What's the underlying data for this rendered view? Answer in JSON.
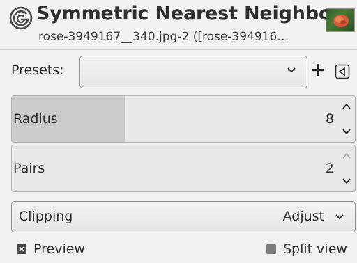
{
  "header": {
    "title": "Symmetric Nearest Neighbor",
    "subtitle": "rose-3949167__340.jpg-2 ([rose-394916…",
    "logo_icon": "gimp-logo-icon",
    "thumbnail_icon": "image-thumbnail-icon"
  },
  "presets": {
    "label": "Presets:",
    "value": "",
    "add_icon": "plus-icon",
    "menu_icon": "menu-triangle-icon"
  },
  "radius": {
    "label": "Radius",
    "value": "8",
    "fill_fraction": 0.33
  },
  "pairs": {
    "label": "Pairs",
    "value": "2",
    "fill_fraction": 0.0
  },
  "clipping": {
    "label": "Clipping",
    "value": "Adjust"
  },
  "options": {
    "preview_label": "Preview",
    "preview_checked": true,
    "split_label": "Split view",
    "split_checked": false
  },
  "colors": {
    "fill": "#cbcbcb",
    "track": "#e8e8e8",
    "text": "#2e2e2e"
  }
}
